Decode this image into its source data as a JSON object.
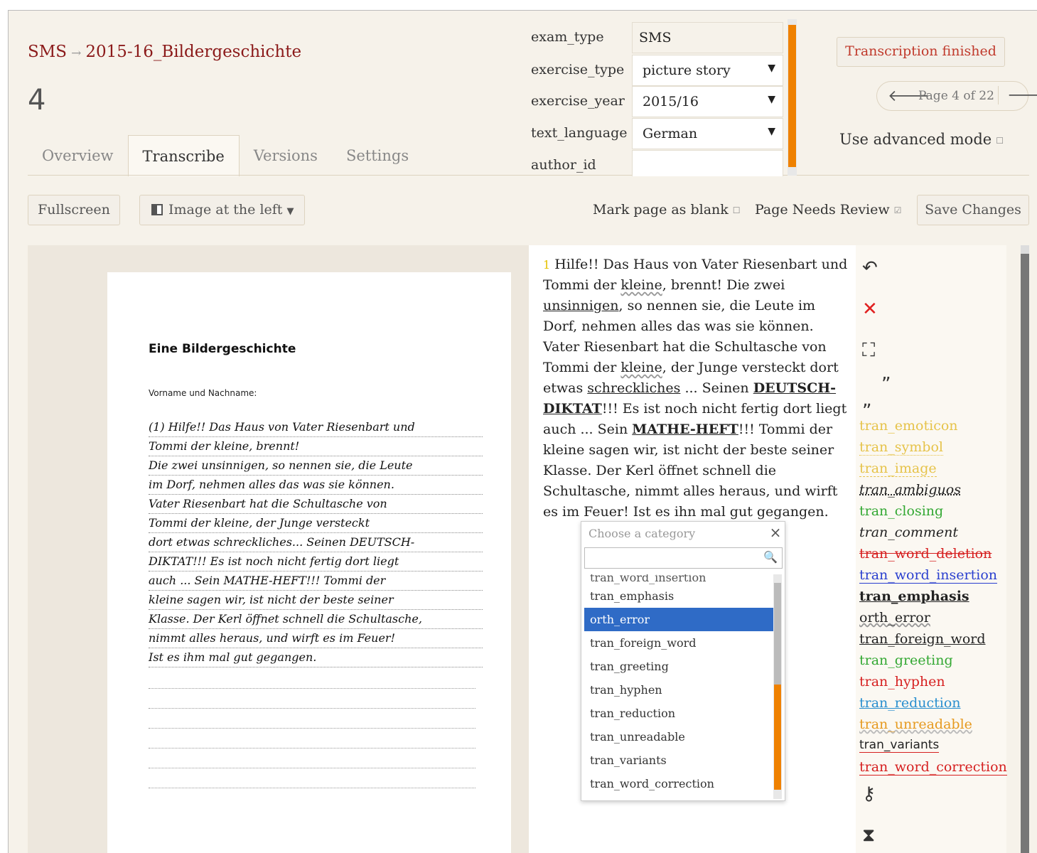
{
  "header": {
    "breadcrumb_root": "SMS",
    "breadcrumb_arrow": "→",
    "breadcrumb_doc": "2015-16_Bildergeschichte",
    "page_number": "4"
  },
  "tabs": [
    {
      "label": "Overview"
    },
    {
      "label": "Transcribe"
    },
    {
      "label": "Versions"
    },
    {
      "label": "Settings"
    }
  ],
  "fields": [
    {
      "label": "exam_type",
      "value": "SMS"
    },
    {
      "label": "exercise_type",
      "value": "picture story"
    },
    {
      "label": "exercise_year",
      "value": "2015/16"
    },
    {
      "label": "text_language",
      "value": "German"
    },
    {
      "label": "author_id",
      "value": ""
    }
  ],
  "status": {
    "finished_label": "Transcription finished",
    "pager_label": "Page 4 of 22",
    "advanced_mode_label": "Use advanced mode"
  },
  "toolbar": {
    "fullscreen_label": "Fullscreen",
    "image_position_label": "Image at the left",
    "mark_blank_label": "Mark page as blank",
    "needs_review_label": "Page Needs Review",
    "save_label": "Save Changes"
  },
  "paper": {
    "title": "Eine Bildergeschichte",
    "name_label": "Vorname und Nachname:",
    "handwriting": [
      "(1) Hilfe!! Das Haus von Vater Riesenbart und",
      "Tommi der kleine, brennt!",
      "Die zwei unsinnigen, so nennen sie, die Leute",
      "im Dorf, nehmen alles das was sie können.",
      "Vater Riesenbart hat die Schultasche von",
      "Tommi der kleine, der Junge versteckt",
      "dort etwas schreckliches... Seinen DEUTSCH-",
      "DIKTAT!!! Es ist noch nicht fertig dort liegt",
      "auch ... Sein MATHE-HEFT!!! Tommi der",
      "kleine sagen wir, ist nicht der beste seiner",
      "Klasse. Der Kerl öffnet schnell die Schultasche,",
      "nimmt alles heraus, und wirft es im Feuer!",
      "Ist es ihm mal gut gegangen."
    ]
  },
  "transcription": {
    "line_number": "1",
    "t1": " Hilfe!! Das Haus von Vater Riesenbart und Tommi der ",
    "w_kleine1": "kleine",
    "t2": ", brennt! Die zwei ",
    "w_unsinnigen": "unsinnigen",
    "t3": ", so nennen sie, die Leute im Dorf, nehmen alles das was sie können. Vater Riesenbart hat die Schultasche von Tommi der ",
    "w_kleine2": "kleine",
    "t4": ", der Junge versteckt dort etwas ",
    "w_schreckliches": "schreckliches",
    "t5": " ... Seinen ",
    "e_deutsch": "DEUTSCH-DIKTAT",
    "t6": "!!! Es ist noch nicht fertig dort liegt auch ... Sein ",
    "e_mathe": "MATHE-HEFT",
    "t7": "!!! Tommi der kleine sagen wir, ist nicht der beste seiner Klasse. Der Kerl öffnet schnell die Schultasche, nimmt alles heraus, und wirft es im Feuer! Ist es ihn mal gut gegangen."
  },
  "dropdown": {
    "placeholder": "Choose a category",
    "close": "×",
    "options": [
      "tran_word_insertion",
      "tran_emphasis",
      "orth_error",
      "tran_foreign_word",
      "tran_greeting",
      "tran_hyphen",
      "tran_reduction",
      "tran_unreadable",
      "tran_variants",
      "tran_word_correction"
    ],
    "highlighted": "orth_error"
  },
  "categories": [
    {
      "label": "tran_emoticon",
      "color": "#e6c34a"
    },
    {
      "label": "tran_symbol",
      "color": "#e6c34a"
    },
    {
      "label": "tran_image",
      "color": "#e6c34a"
    },
    {
      "label": "tran_ambiguos",
      "color": "#222222"
    },
    {
      "label": "tran_closing",
      "color": "#33a833"
    },
    {
      "label": "tran_comment",
      "color": "#222222"
    },
    {
      "label": "tran_word_deletion",
      "color": "#d62020"
    },
    {
      "label": "tran_word_insertion",
      "color": "#2a3fcf"
    },
    {
      "label": "tran_emphasis",
      "color": "#222222"
    },
    {
      "label": "orth_error",
      "color": "#222222"
    },
    {
      "label": "tran_foreign_word",
      "color": "#222222"
    },
    {
      "label": "tran_greeting",
      "color": "#33a833"
    },
    {
      "label": "tran_hyphen",
      "color": "#d62020"
    },
    {
      "label": "tran_reduction",
      "color": "#2a8fcf"
    },
    {
      "label": "tran_unreadable",
      "color": "#e69a20"
    },
    {
      "label": "tran_variants",
      "color": "#222222"
    },
    {
      "label": "tran_word_correction",
      "color": "#d62020"
    }
  ],
  "icons": {
    "undo": "↶",
    "delete": "✕",
    "select": "⛶",
    "quote_close": "”",
    "quote_open": "„",
    "key": "⚷",
    "hourglass": "⧗"
  },
  "colors": {
    "accent": "#8b1a1a",
    "scrollbar": "#ef8100",
    "highlight": "#2f6bc6"
  }
}
